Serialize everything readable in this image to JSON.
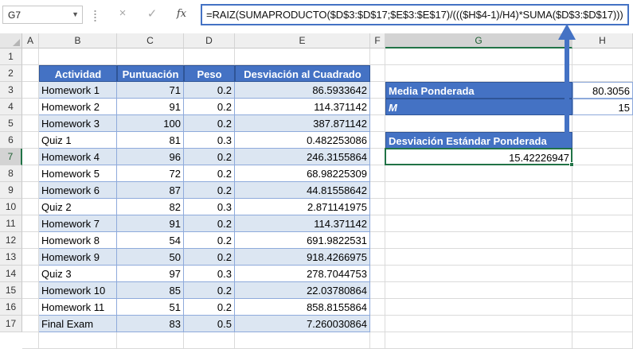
{
  "formula_bar": {
    "name_box": "G7",
    "cancel_icon": "×",
    "enter_icon": "✓",
    "fx_label": "fx",
    "formula": "=RAIZ(SUMAPRODUCTO($D$3:$D$17;$E$3:$E$17)/((($H$4-1)/H4)*SUMA($D$3:$D$17)))"
  },
  "columns": [
    "A",
    "B",
    "C",
    "D",
    "E",
    "F",
    "G",
    "H"
  ],
  "rows": [
    "1",
    "2",
    "3",
    "4",
    "5",
    "6",
    "7",
    "8",
    "9",
    "10",
    "11",
    "12",
    "13",
    "14",
    "15",
    "16",
    "17"
  ],
  "selected_cell": "G7",
  "table": {
    "headers": [
      "Actividad",
      "Puntuación",
      "Peso",
      "Desviación al Cuadrado"
    ],
    "rows": [
      [
        "Homework 1",
        "71",
        "0.2",
        "86.5933642"
      ],
      [
        "Homework 2",
        "91",
        "0.2",
        "114.371142"
      ],
      [
        "Homework 3",
        "100",
        "0.2",
        "387.871142"
      ],
      [
        "Quiz 1",
        "81",
        "0.3",
        "0.482253086"
      ],
      [
        "Homework 4",
        "96",
        "0.2",
        "246.3155864"
      ],
      [
        "Homework 5",
        "72",
        "0.2",
        "68.98225309"
      ],
      [
        "Homework 6",
        "87",
        "0.2",
        "44.81558642"
      ],
      [
        "Quiz 2",
        "82",
        "0.3",
        "2.871141975"
      ],
      [
        "Homework 7",
        "91",
        "0.2",
        "114.371142"
      ],
      [
        "Homework 8",
        "54",
        "0.2",
        "691.9822531"
      ],
      [
        "Homework 9",
        "50",
        "0.2",
        "918.4266975"
      ],
      [
        "Quiz 3",
        "97",
        "0.3",
        "278.7044753"
      ],
      [
        "Homework 10",
        "85",
        "0.2",
        "22.03780864"
      ],
      [
        "Homework 11",
        "51",
        "0.2",
        "858.8155864"
      ],
      [
        "Final Exam",
        "83",
        "0.5",
        "7.260030864"
      ]
    ]
  },
  "summary": {
    "mean_label": "Media Ponderada",
    "mean_value": "80.3056",
    "m_label": "M",
    "m_value": "15",
    "std_label": "Desviación Estándar Ponderada",
    "std_value": "15.42226947"
  },
  "colors": {
    "header_blue": "#4472c4",
    "band_blue": "#dce6f2",
    "selection_green": "#217346",
    "arrow_blue": "#4472c4"
  }
}
